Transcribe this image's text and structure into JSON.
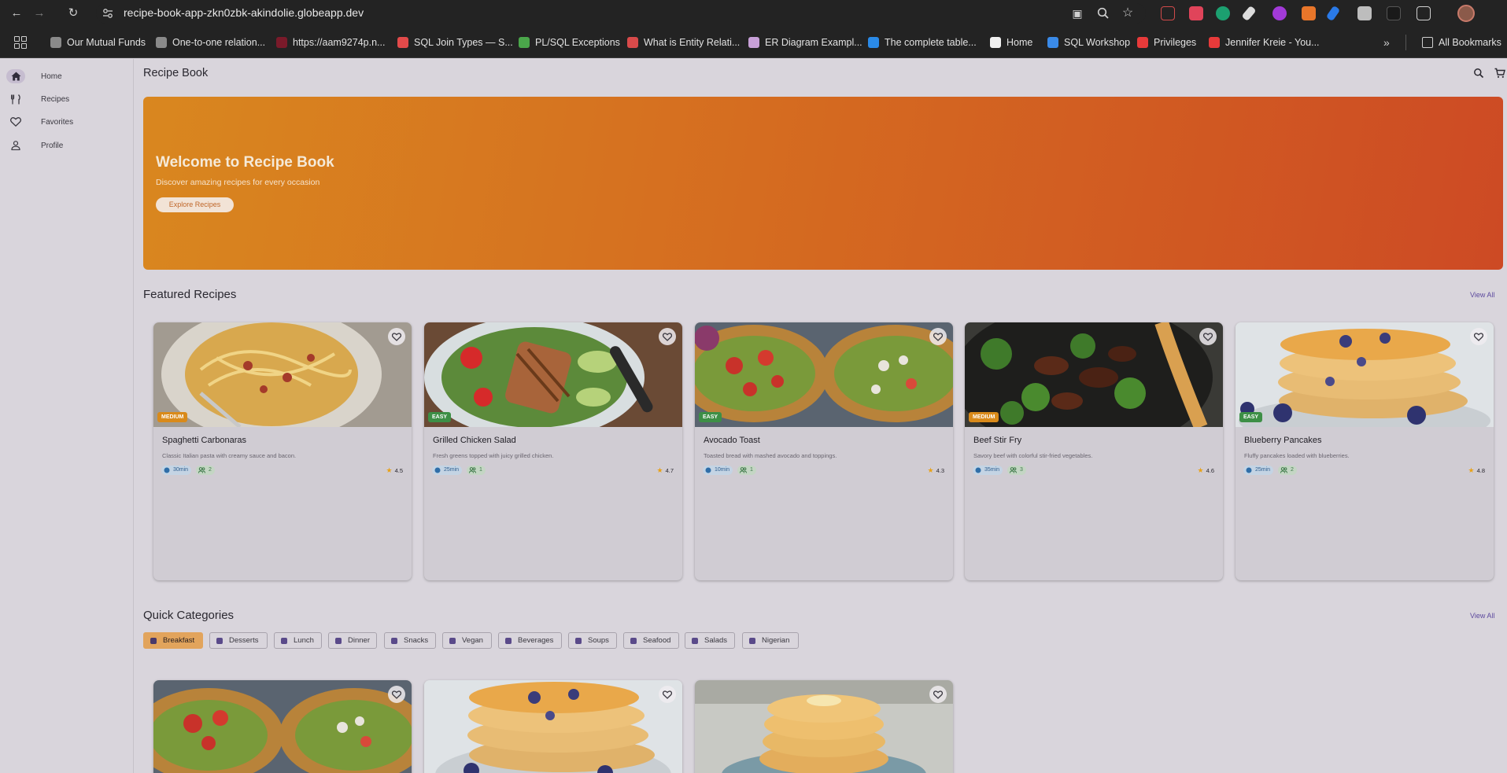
{
  "browser": {
    "url": "recipe-book-app-zkn0zbk-akindolie.globeapp.dev",
    "bookmarks": [
      {
        "label": "Our Mutual Funds",
        "color": "#8a8a8a"
      },
      {
        "label": "One-to-one relation...",
        "color": "#8a8a8a"
      },
      {
        "label": "https://aam9274p.n...",
        "color": "#7a1a2a"
      },
      {
        "label": "SQL Join Types — S...",
        "color": "#e24a4a"
      },
      {
        "label": "PL/SQL Exceptions",
        "color": "#4aa64a"
      },
      {
        "label": "What is Entity Relati...",
        "color": "#d84a4a"
      },
      {
        "label": "ER Diagram Exampl...",
        "color": "#c8a0d8"
      },
      {
        "label": "The complete table...",
        "color": "#2a8ae8"
      },
      {
        "label": "Home",
        "color": "#f0f0f0"
      },
      {
        "label": "SQL Workshop",
        "color": "#3a8ae8"
      },
      {
        "label": "Privileges",
        "color": "#e83a3a"
      },
      {
        "label": "Jennifer Kreie - You...",
        "color": "#e83a3a"
      }
    ],
    "all_bookmarks": "All Bookmarks"
  },
  "sidebar": {
    "items": [
      {
        "label": "Home",
        "icon": "home-icon"
      },
      {
        "label": "Recipes",
        "icon": "utensils-icon"
      },
      {
        "label": "Favorites",
        "icon": "heart-icon"
      },
      {
        "label": "Profile",
        "icon": "person-icon"
      }
    ]
  },
  "header": {
    "title": "Recipe Book"
  },
  "hero": {
    "title": "Welcome to Recipe Book",
    "subtitle": "Discover amazing recipes for every occasion",
    "button": "Explore Recipes"
  },
  "featured": {
    "title": "Featured Recipes",
    "view_all": "View All",
    "recipes": [
      {
        "title": "Spaghetti Carbonaras",
        "desc": "Classic Italian pasta with creamy sauce and bacon.",
        "difficulty": "MEDIUM",
        "time": "30min",
        "servings": "2",
        "rating": "4.5"
      },
      {
        "title": "Grilled Chicken Salad",
        "desc": "Fresh greens topped with juicy grilled chicken.",
        "difficulty": "EASY",
        "time": "25min",
        "servings": "1",
        "rating": "4.7"
      },
      {
        "title": "Avocado Toast",
        "desc": "Toasted bread with mashed avocado and toppings.",
        "difficulty": "EASY",
        "time": "10min",
        "servings": "1",
        "rating": "4.3"
      },
      {
        "title": "Beef Stir Fry",
        "desc": "Savory beef with colorful stir-fried vegetables.",
        "difficulty": "MEDIUM",
        "time": "35min",
        "servings": "3",
        "rating": "4.6"
      },
      {
        "title": "Blueberry Pancakes",
        "desc": "Fluffy pancakes loaded with blueberries.",
        "difficulty": "EASY",
        "time": "25min",
        "servings": "2",
        "rating": "4.8"
      }
    ]
  },
  "categories": {
    "title": "Quick Categories",
    "view_all": "View All",
    "items": [
      "Breakfast",
      "Desserts",
      "Lunch",
      "Dinner",
      "Snacks",
      "Vegan",
      "Beverages",
      "Soups",
      "Seafood",
      "Salads",
      "Nigerian"
    ],
    "selected": "Breakfast"
  },
  "colors": {
    "easy": "#3d8f46",
    "medium": "#d98a1a",
    "accent": "#5d4a9e"
  }
}
